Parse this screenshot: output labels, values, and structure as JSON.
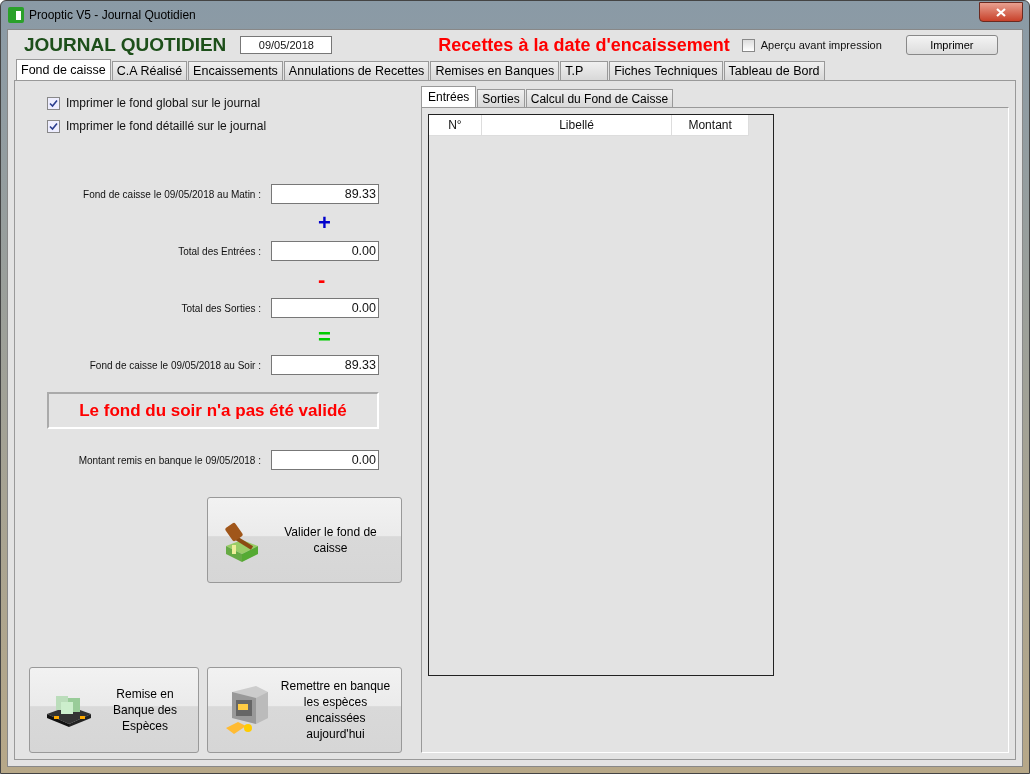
{
  "window": {
    "title": "Prooptic V5 - Journal Quotidien"
  },
  "header": {
    "title": "JOURNAL QUOTIDIEN",
    "date": "09/05/2018",
    "subtitle": "Recettes à la date d'encaissement",
    "preview": {
      "label": "Aperçu avant impression",
      "checked": false
    },
    "print_button": "Imprimer"
  },
  "tabs": [
    {
      "label": "Fond de caisse",
      "selected": true
    },
    {
      "label": "C.A Réalisé",
      "selected": false
    },
    {
      "label": "Encaissements",
      "selected": false
    },
    {
      "label": "Annulations de Recettes",
      "selected": false
    },
    {
      "label": "Remises en Banques",
      "selected": false
    },
    {
      "label": "T.P",
      "selected": false
    },
    {
      "label": "Fiches Techniques",
      "selected": false
    },
    {
      "label": "Tableau de Bord",
      "selected": false
    }
  ],
  "options": [
    {
      "label": "Imprimer le fond global sur le journal",
      "checked": true
    },
    {
      "label": "Imprimer le fond détaillé sur le journal",
      "checked": true
    }
  ],
  "rows": [
    {
      "kind": "field",
      "label": "Fond de caisse le 09/05/2018 au Matin :",
      "value": "89.33"
    },
    {
      "kind": "operator",
      "text": "+",
      "color": "#0000cc"
    },
    {
      "kind": "field",
      "label": "Total des Entrées :",
      "value": "0.00"
    },
    {
      "kind": "operator",
      "text": "-",
      "color": "#ff0000"
    },
    {
      "kind": "field",
      "label": "Total des Sorties :",
      "value": "0.00"
    },
    {
      "kind": "operator",
      "text": "=",
      "color": "#00cc00"
    },
    {
      "kind": "field",
      "label": "Fond de caisse le 09/05/2018 au Soir :",
      "value": "89.33"
    }
  ],
  "status_message": "Le fond du soir n'a pas été validé",
  "bank_row": {
    "label": "Montant remis en banque le 09/05/2018 :",
    "value": "0.00"
  },
  "validate_button": "Valider le fond de caisse",
  "bottom_buttons": [
    {
      "kind": "briefcase",
      "label": "Remise en Banque des Espèces"
    },
    {
      "kind": "safe",
      "label": "Remettre en banque les espèces encaissées aujourd'hui"
    }
  ],
  "inner_tabs": [
    {
      "label": "Entrées",
      "selected": true
    },
    {
      "label": "Sorties",
      "selected": false
    },
    {
      "label": "Calcul du Fond de Caisse",
      "selected": false
    }
  ],
  "table": {
    "columns": [
      "N°",
      "Libellé",
      "Montant"
    ]
  }
}
